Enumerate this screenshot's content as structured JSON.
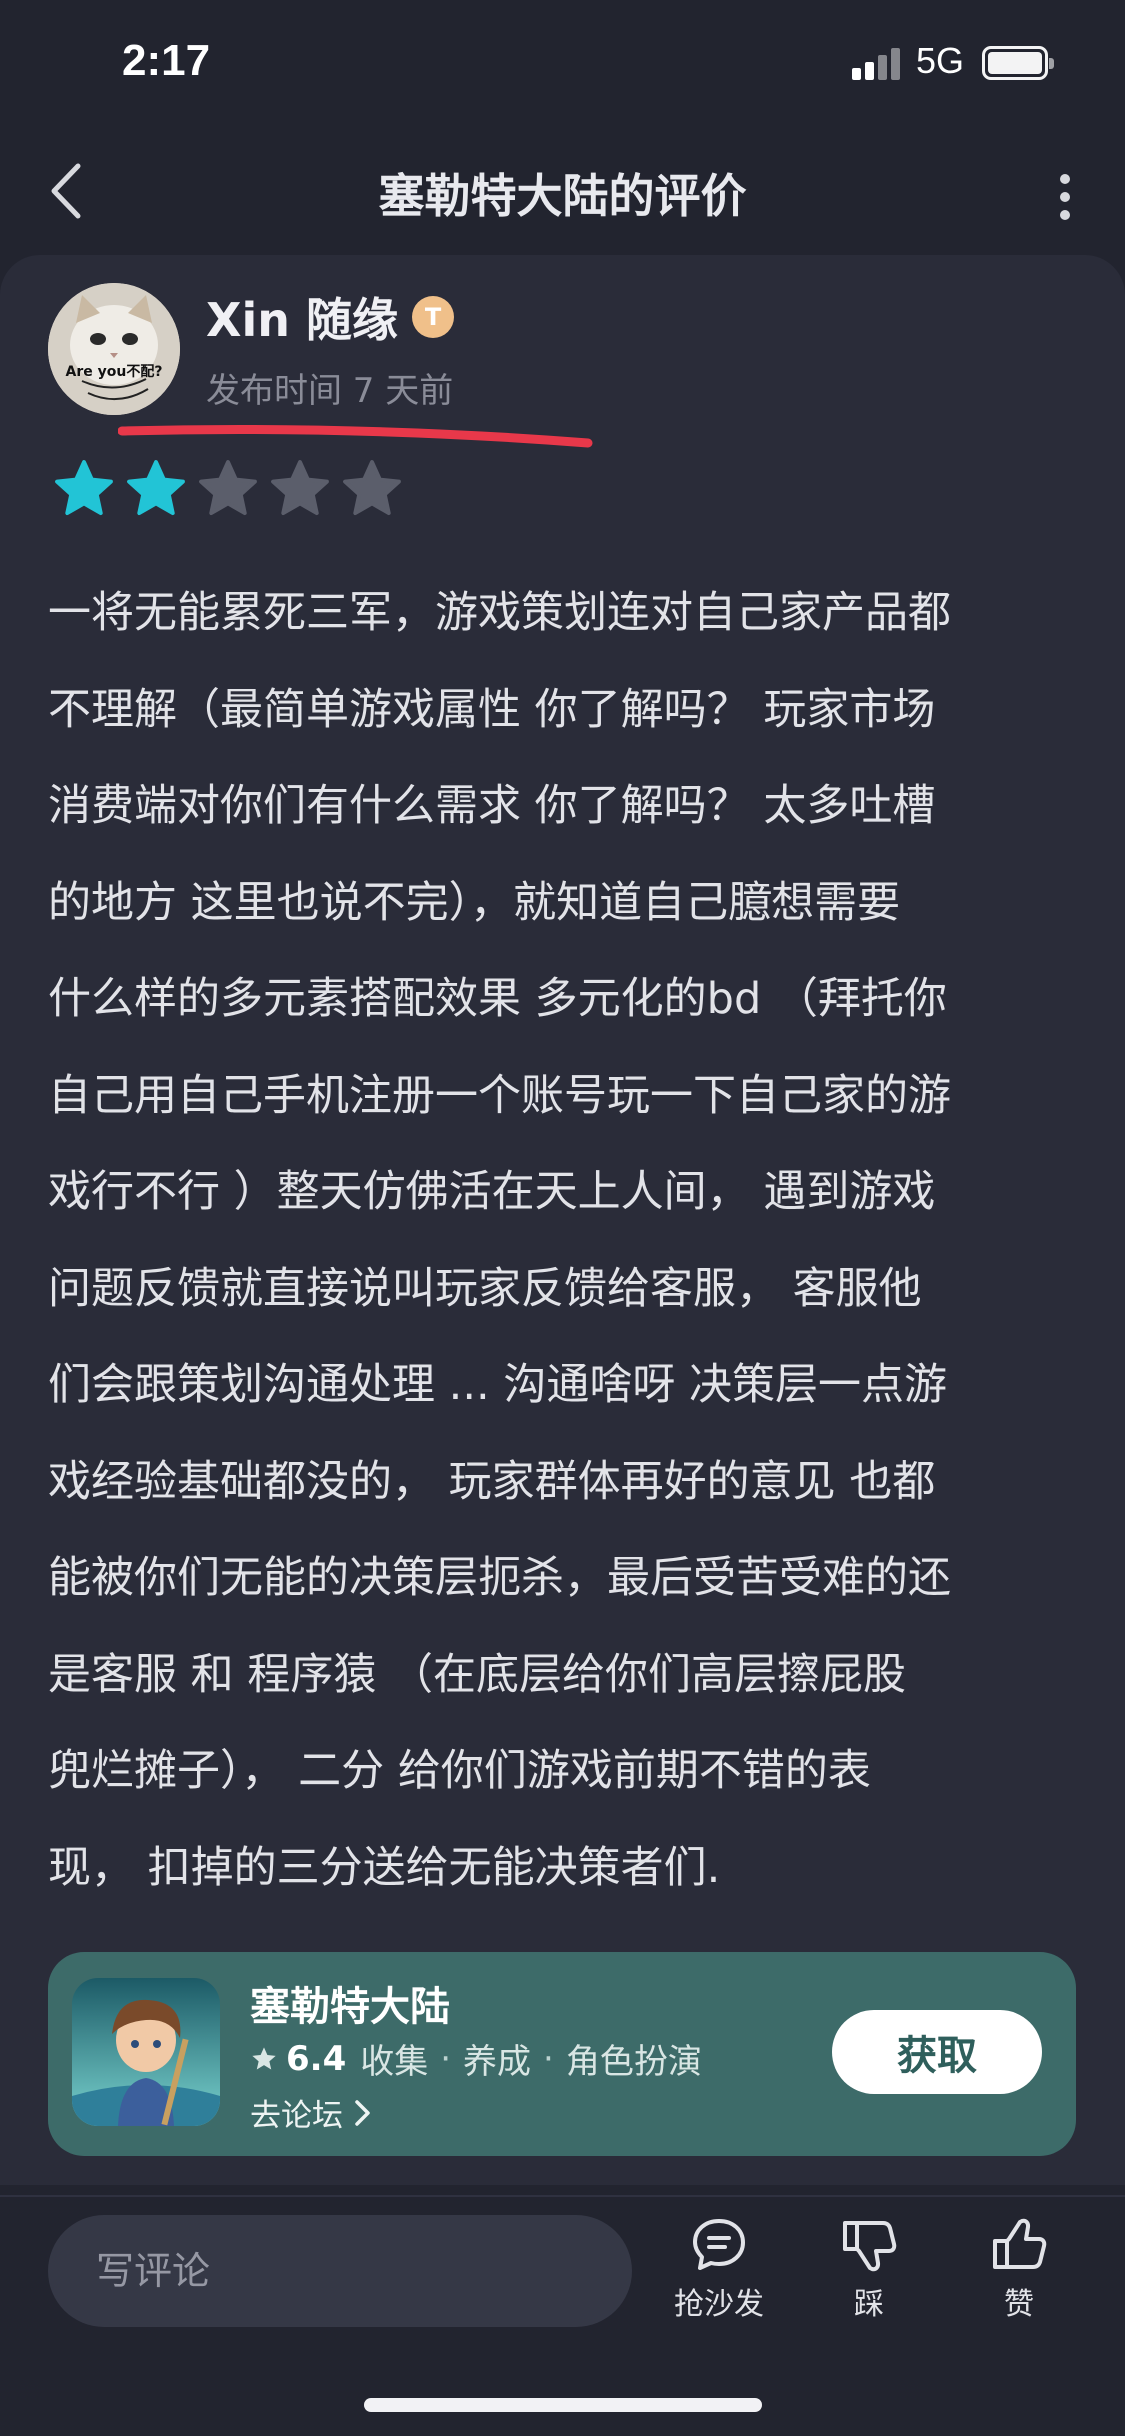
{
  "status_bar": {
    "time": "2:17",
    "network": "5G"
  },
  "header": {
    "title": "塞勒特大陆的评价"
  },
  "review": {
    "author": "Xin 随缘",
    "author_badge": "T",
    "avatar_caption": "Are you不配?",
    "publish_time": "发布时间 7 天前",
    "rating": 2,
    "rating_max": 5,
    "lines": [
      "一将无能累死三军，游戏策划连对自己家产品都",
      "不理解（最简单游戏属性 你了解吗？ 玩家市场",
      "消费端对你们有什么需求 你了解吗？ 太多吐槽",
      "的地方 这里也说不完），就知道自己臆想需要",
      "什么样的多元素搭配效果 多元化的bd （拜托你",
      "自己用自己手机注册一个账号玩一下自己家的游",
      "戏行不行 ）整天仿佛活在天上人间， 遇到游戏",
      "问题反馈就直接说叫玩家反馈给客服， 客服他",
      "们会跟策划沟通处理 ... 沟通啥呀 决策层一点游",
      "戏经验基础都没的， 玩家群体再好的意见 也都",
      "能被你们无能的决策层扼杀，最后受苦受难的还",
      "是客服 和 程序猿 （在底层给你们高层擦屁股",
      "兜烂摊子）， 二分 给你们游戏前期不错的表",
      "现， 扣掉的三分送给无能决策者们."
    ]
  },
  "game": {
    "name": "塞勒特大陆",
    "score": "6.4",
    "tags": [
      "收集",
      "养成",
      "角色扮演"
    ],
    "forum_link": "去论坛",
    "get_button": "获取"
  },
  "bottom_bar": {
    "comment_placeholder": "写评论",
    "actions": [
      {
        "label": "抢沙发",
        "icon": "comment-bubble-icon"
      },
      {
        "label": "踩",
        "icon": "thumbs-down-icon"
      },
      {
        "label": "赞",
        "icon": "thumbs-up-icon"
      }
    ]
  },
  "colors": {
    "background": "#22242f",
    "card": "#2a2c39",
    "star_filled": "#22c4d6",
    "star_empty": "#5b5e6b",
    "game_card": "#3d6b69",
    "annotation_red": "#e8384a"
  }
}
